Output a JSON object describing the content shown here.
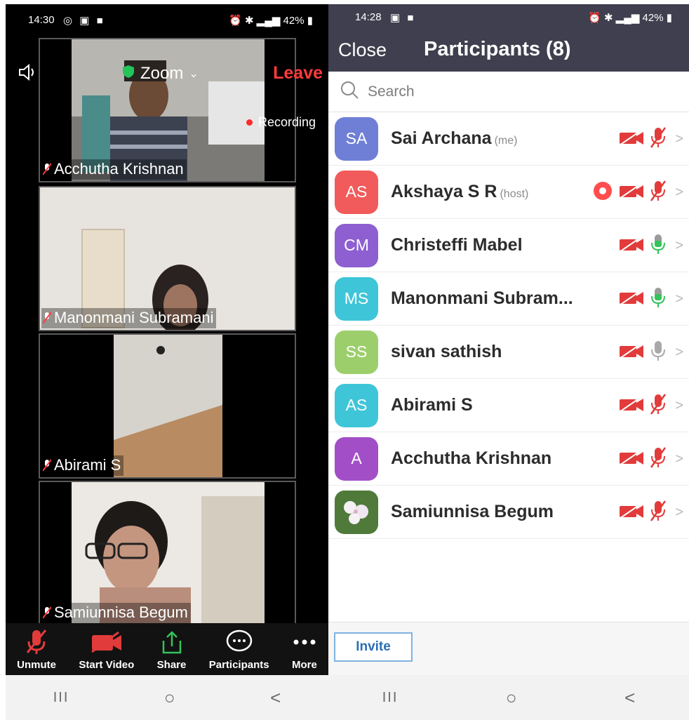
{
  "left_screen": {
    "status": {
      "time": "14:30",
      "battery": "42%"
    },
    "meeting_title": "Zoom",
    "leave_label": "Leave",
    "recording_label": "Recording",
    "tiles": [
      {
        "name": "Acchutha Krishnan"
      },
      {
        "name": "Manonmani Subramani"
      },
      {
        "name": "Abirami S"
      },
      {
        "name": "Samiunnisa Begum"
      }
    ],
    "toolbar": {
      "unmute": "Unmute",
      "start_video": "Start Video",
      "share": "Share",
      "participants": "Participants",
      "more": "More"
    }
  },
  "right_screen": {
    "status": {
      "time": "14:28",
      "battery": "42%"
    },
    "close_label": "Close",
    "title": "Participants (8)",
    "search_placeholder": "Search",
    "participants": [
      {
        "initials": "SA",
        "name": "Sai Archana",
        "tag": "(me)",
        "color": "#6f7fd6",
        "mic": "muted"
      },
      {
        "initials": "AS",
        "name": "Akshaya S R",
        "tag": "(host)",
        "color": "#f25b5b",
        "mic": "muted"
      },
      {
        "initials": "CM",
        "name": "Christeffi Mabel",
        "tag": "",
        "color": "#8d5fd1",
        "mic": "active"
      },
      {
        "initials": "MS",
        "name": "Manonmani Subram...",
        "tag": "",
        "color": "#3fc5d8",
        "mic": "active"
      },
      {
        "initials": "SS",
        "name": "sivan sathish",
        "tag": "",
        "color": "#9ccf6c",
        "mic": "idle"
      },
      {
        "initials": "AS",
        "name": "Abirami S",
        "tag": "",
        "color": "#3fc5d8",
        "mic": "muted"
      },
      {
        "initials": "A",
        "name": "Acchutha Krishnan",
        "tag": "",
        "color": "#a24fc7",
        "mic": "muted"
      },
      {
        "initials": "",
        "name": "Samiunnisa Begum",
        "tag": "",
        "color": "#6a8f4a",
        "mic": "muted"
      }
    ],
    "invite_label": "Invite"
  },
  "nav_buttons": {
    "recents": "III",
    "home": "○",
    "back": "<"
  }
}
